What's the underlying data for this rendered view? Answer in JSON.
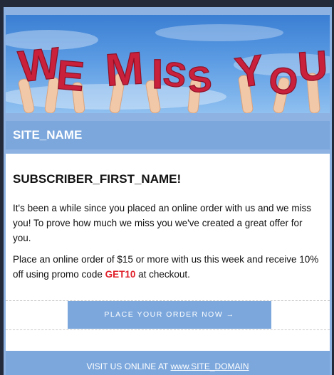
{
  "hero": {
    "headline": "WE MISS YOU",
    "headline_color": "#c9203c"
  },
  "site": {
    "name": "SITE_NAME"
  },
  "email": {
    "greeting": "SUBSCRIBER_FIRST_NAME!",
    "paragraph1": "It's been a while since you placed an online order with us and we miss you! To prove how much we miss you we've created a great offer for you.",
    "paragraph2_before": "Place an online order of $15 or more with us this week and receive 10% off using promo code ",
    "promo_code": "GET10",
    "paragraph2_after": " at checkout."
  },
  "cta": {
    "label": "PLACE YOUR ORDER NOW →"
  },
  "footer": {
    "prefix": "VISIT US ONLINE AT ",
    "link": "www.SITE_DOMAIN"
  },
  "colors": {
    "accent": "#7ba7dd",
    "promo": "#e0202a",
    "page_bg": "#232b3a"
  }
}
